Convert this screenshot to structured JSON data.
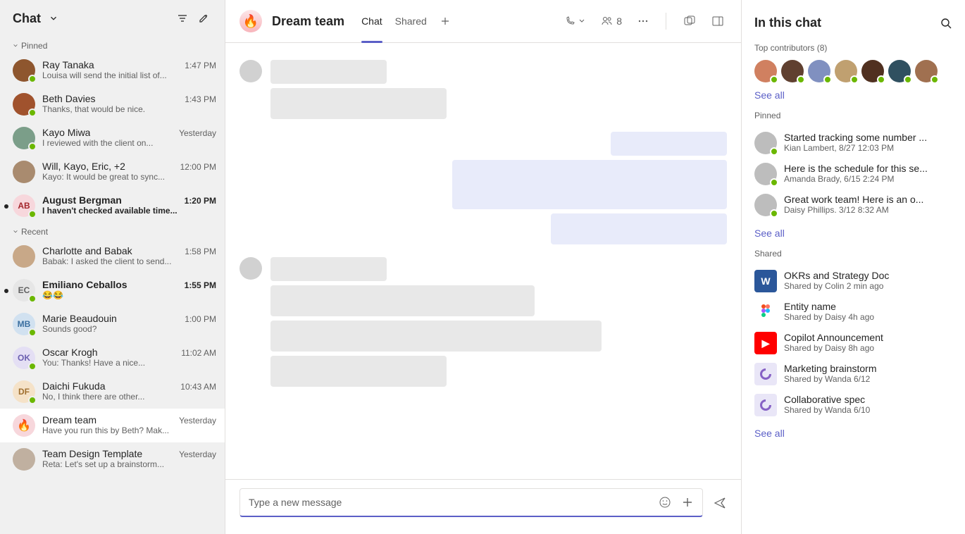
{
  "sidebar": {
    "title": "Chat",
    "sections": {
      "pinned_label": "Pinned",
      "recent_label": "Recent"
    },
    "pinned": [
      {
        "name": "Ray Tanaka",
        "time": "1:47 PM",
        "preview": "Louisa will send the initial list of...",
        "avatar_bg": "#8e562e",
        "presence": true
      },
      {
        "name": "Beth Davies",
        "time": "1:43 PM",
        "preview": "Thanks, that would be nice.",
        "avatar_bg": "#a0522d",
        "presence": true
      },
      {
        "name": "Kayo Miwa",
        "time": "Yesterday",
        "preview": "I reviewed with the client on...",
        "avatar_bg": "#7b9e89",
        "presence": true
      },
      {
        "name": "Will, Kayo, Eric, +2",
        "time": "12:00 PM",
        "preview": "Kayo: It would be great to sync...",
        "avatar_bg": "#a98b6f",
        "presence": false,
        "group": true
      },
      {
        "name": "August Bergman",
        "time": "1:20 PM",
        "preview": "I haven't checked available time...",
        "avatar_bg": "#f7d7dc",
        "initials": "AB",
        "initials_color": "#a4262c",
        "presence": true,
        "unread": true
      }
    ],
    "recent": [
      {
        "name": "Charlotte and Babak",
        "time": "1:58 PM",
        "preview": "Babak: I asked the client to send...",
        "avatar_bg": "#c8a888",
        "presence": false,
        "group": true
      },
      {
        "name": "Emiliano Ceballos",
        "time": "1:55 PM",
        "preview": "😂😂",
        "avatar_bg": "#e6e6e6",
        "initials": "EC",
        "initials_color": "#616161",
        "presence": true,
        "unread": true
      },
      {
        "name": "Marie Beaudouin",
        "time": "1:00 PM",
        "preview": "Sounds good?",
        "avatar_bg": "#d1e1f0",
        "initials": "MB",
        "initials_color": "#3b6fa0",
        "presence": true
      },
      {
        "name": "Oscar Krogh",
        "time": "11:02 AM",
        "preview": "You: Thanks! Have a nice...",
        "avatar_bg": "#e4dff4",
        "initials": "OK",
        "initials_color": "#6b5fb0",
        "presence": true
      },
      {
        "name": "Daichi Fukuda",
        "time": "10:43 AM",
        "preview": "No, I think there are other...",
        "avatar_bg": "#f5e2c8",
        "initials": "DF",
        "initials_color": "#a07030",
        "presence": true
      },
      {
        "name": "Dream team",
        "time": "Yesterday",
        "preview": "Have you run this by Beth? Mak...",
        "avatar_bg": "#f7d7dc",
        "emoji": "🔥",
        "presence": false,
        "selected": true
      },
      {
        "name": "Team Design Template",
        "time": "Yesterday",
        "preview": "Reta: Let's set up a brainstorm...",
        "avatar_bg": "#c0b0a0",
        "presence": false,
        "group": true
      }
    ]
  },
  "header": {
    "title": "Dream team",
    "emoji": "🔥",
    "tabs": [
      {
        "label": "Chat",
        "active": true
      },
      {
        "label": "Shared",
        "active": false
      }
    ],
    "participants_count": "8"
  },
  "compose": {
    "placeholder": "Type a new message"
  },
  "rightpanel": {
    "title": "In this chat",
    "contributors_label": "Top contributors (8)",
    "contributors_count": 7,
    "seeall": "See all",
    "pinned_label": "Pinned",
    "pinned": [
      {
        "title": "Started tracking some number ...",
        "sub": "Kian Lambert, 8/27 12:03 PM"
      },
      {
        "title": "Here is the schedule for this se...",
        "sub": "Amanda Brady, 6/15 2:24 PM"
      },
      {
        "title": "Great work team! Here is an o...",
        "sub": "Daisy Phillips. 3/12 8:32 AM"
      }
    ],
    "shared_label": "Shared",
    "shared": [
      {
        "title": "OKRs and Strategy Doc",
        "sub": "Shared by Colin 2 min ago",
        "icon_bg": "#2b579a",
        "icon_text": "W"
      },
      {
        "title": "Entity name",
        "sub": "Shared by Daisy 4h ago",
        "icon_bg": "#ffffff",
        "icon_text": "",
        "figma": true
      },
      {
        "title": "Copilot Announcement",
        "sub": "Shared by Daisy 8h ago",
        "icon_bg": "#ff0000",
        "icon_text": "▶"
      },
      {
        "title": "Marketing brainstorm",
        "sub": "Shared by Wanda 6/12",
        "icon_bg": "#e9e6f7",
        "icon_text": "",
        "loop": true
      },
      {
        "title": "Collaborative spec",
        "sub": "Shared by Wanda 6/10",
        "icon_bg": "#e9e6f7",
        "icon_text": "",
        "loop": true
      }
    ]
  }
}
